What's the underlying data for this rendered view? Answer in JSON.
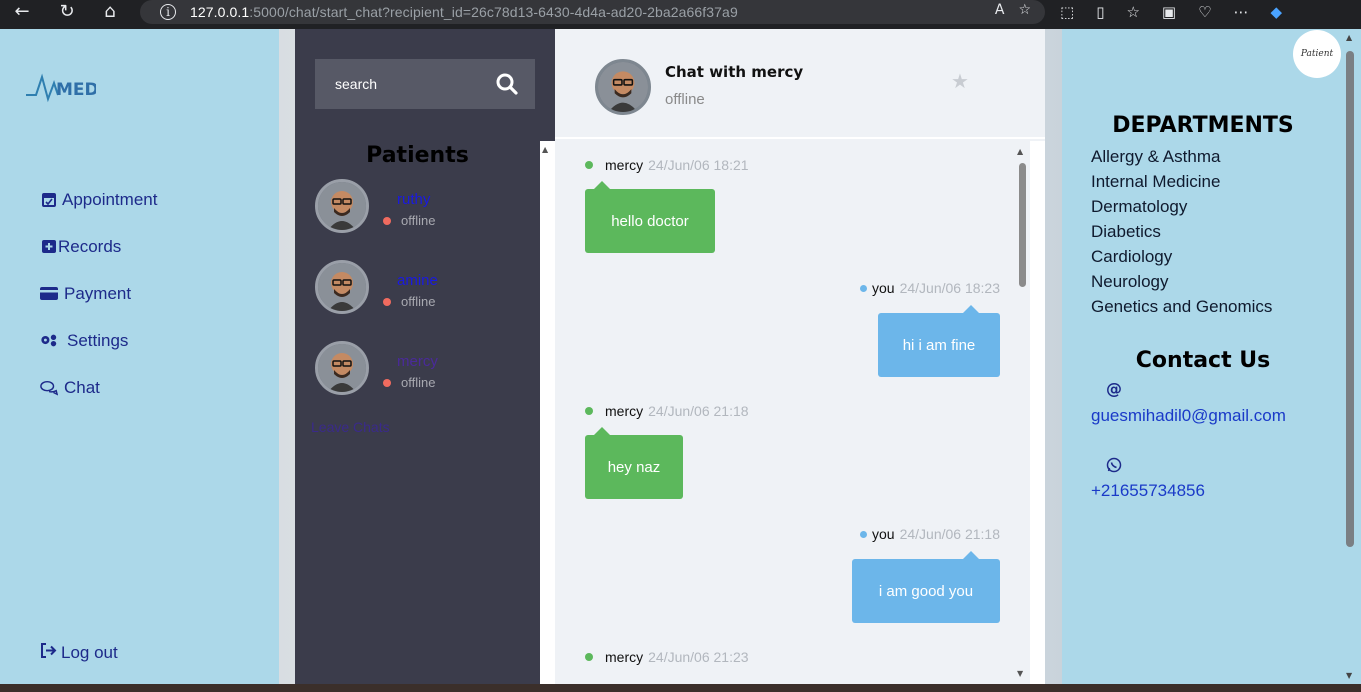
{
  "browser": {
    "url_host": "127.0.0.1",
    "url_path": ":5000/chat/start_chat?recipient_id=26c78d13-6430-4d4a-ad20-2ba2a66f37a9"
  },
  "sidebar": {
    "logo_text": "MEDX",
    "items": [
      {
        "label": "Appointment",
        "icon": "calendar-check-icon"
      },
      {
        "label": "Records",
        "icon": "medical-record-icon"
      },
      {
        "label": "Payment",
        "icon": "credit-card-icon"
      },
      {
        "label": "Settings",
        "icon": "gears-icon"
      },
      {
        "label": "Chat",
        "icon": "chat-bubbles-icon"
      }
    ],
    "logout_label": "Log out"
  },
  "patients": {
    "search_placeholder": "search",
    "title": "Patients",
    "list": [
      {
        "name": "ruthy",
        "status": "offline"
      },
      {
        "name": "amine",
        "status": "offline"
      },
      {
        "name": "mercy",
        "status": "offline"
      }
    ],
    "leave_label": "Leave Chats"
  },
  "chat": {
    "title": "Chat with mercy",
    "status": "offline",
    "messages": [
      {
        "sender": "mercy",
        "time": "24/Jun/06 18:21",
        "text": "hello doctor",
        "side": "left"
      },
      {
        "sender": "you",
        "time": "24/Jun/06 18:23",
        "text": "hi i am fine",
        "side": "right"
      },
      {
        "sender": "mercy",
        "time": "24/Jun/06 21:18",
        "text": "hey naz",
        "side": "left"
      },
      {
        "sender": "you",
        "time": "24/Jun/06 21:18",
        "text": "i am good you",
        "side": "right"
      },
      {
        "sender": "mercy",
        "time": "24/Jun/06 21:23",
        "text": "",
        "side": "left"
      }
    ]
  },
  "right": {
    "departments_title": "DEPARTMENTS",
    "departments": [
      "Allergy & Asthma",
      "Internal Medicine",
      "Dermatology",
      "Diabetics",
      "Cardiology",
      "Neurology",
      "Genetics and Genomics"
    ],
    "contact_title": "Contact Us",
    "at_symbol": "@",
    "email": "guesmihadil0@gmail.com",
    "phone": "+21655734856",
    "profile_badge_text": "Patient"
  },
  "colors": {
    "sidebar_bg": "#acd8e9",
    "patients_bg": "#3b3c4b",
    "chat_bg": "#eff2f6",
    "incoming_bubble": "#5cb85c",
    "outgoing_bubble": "#6cb6ea",
    "menu_text": "#1d2a8a"
  }
}
